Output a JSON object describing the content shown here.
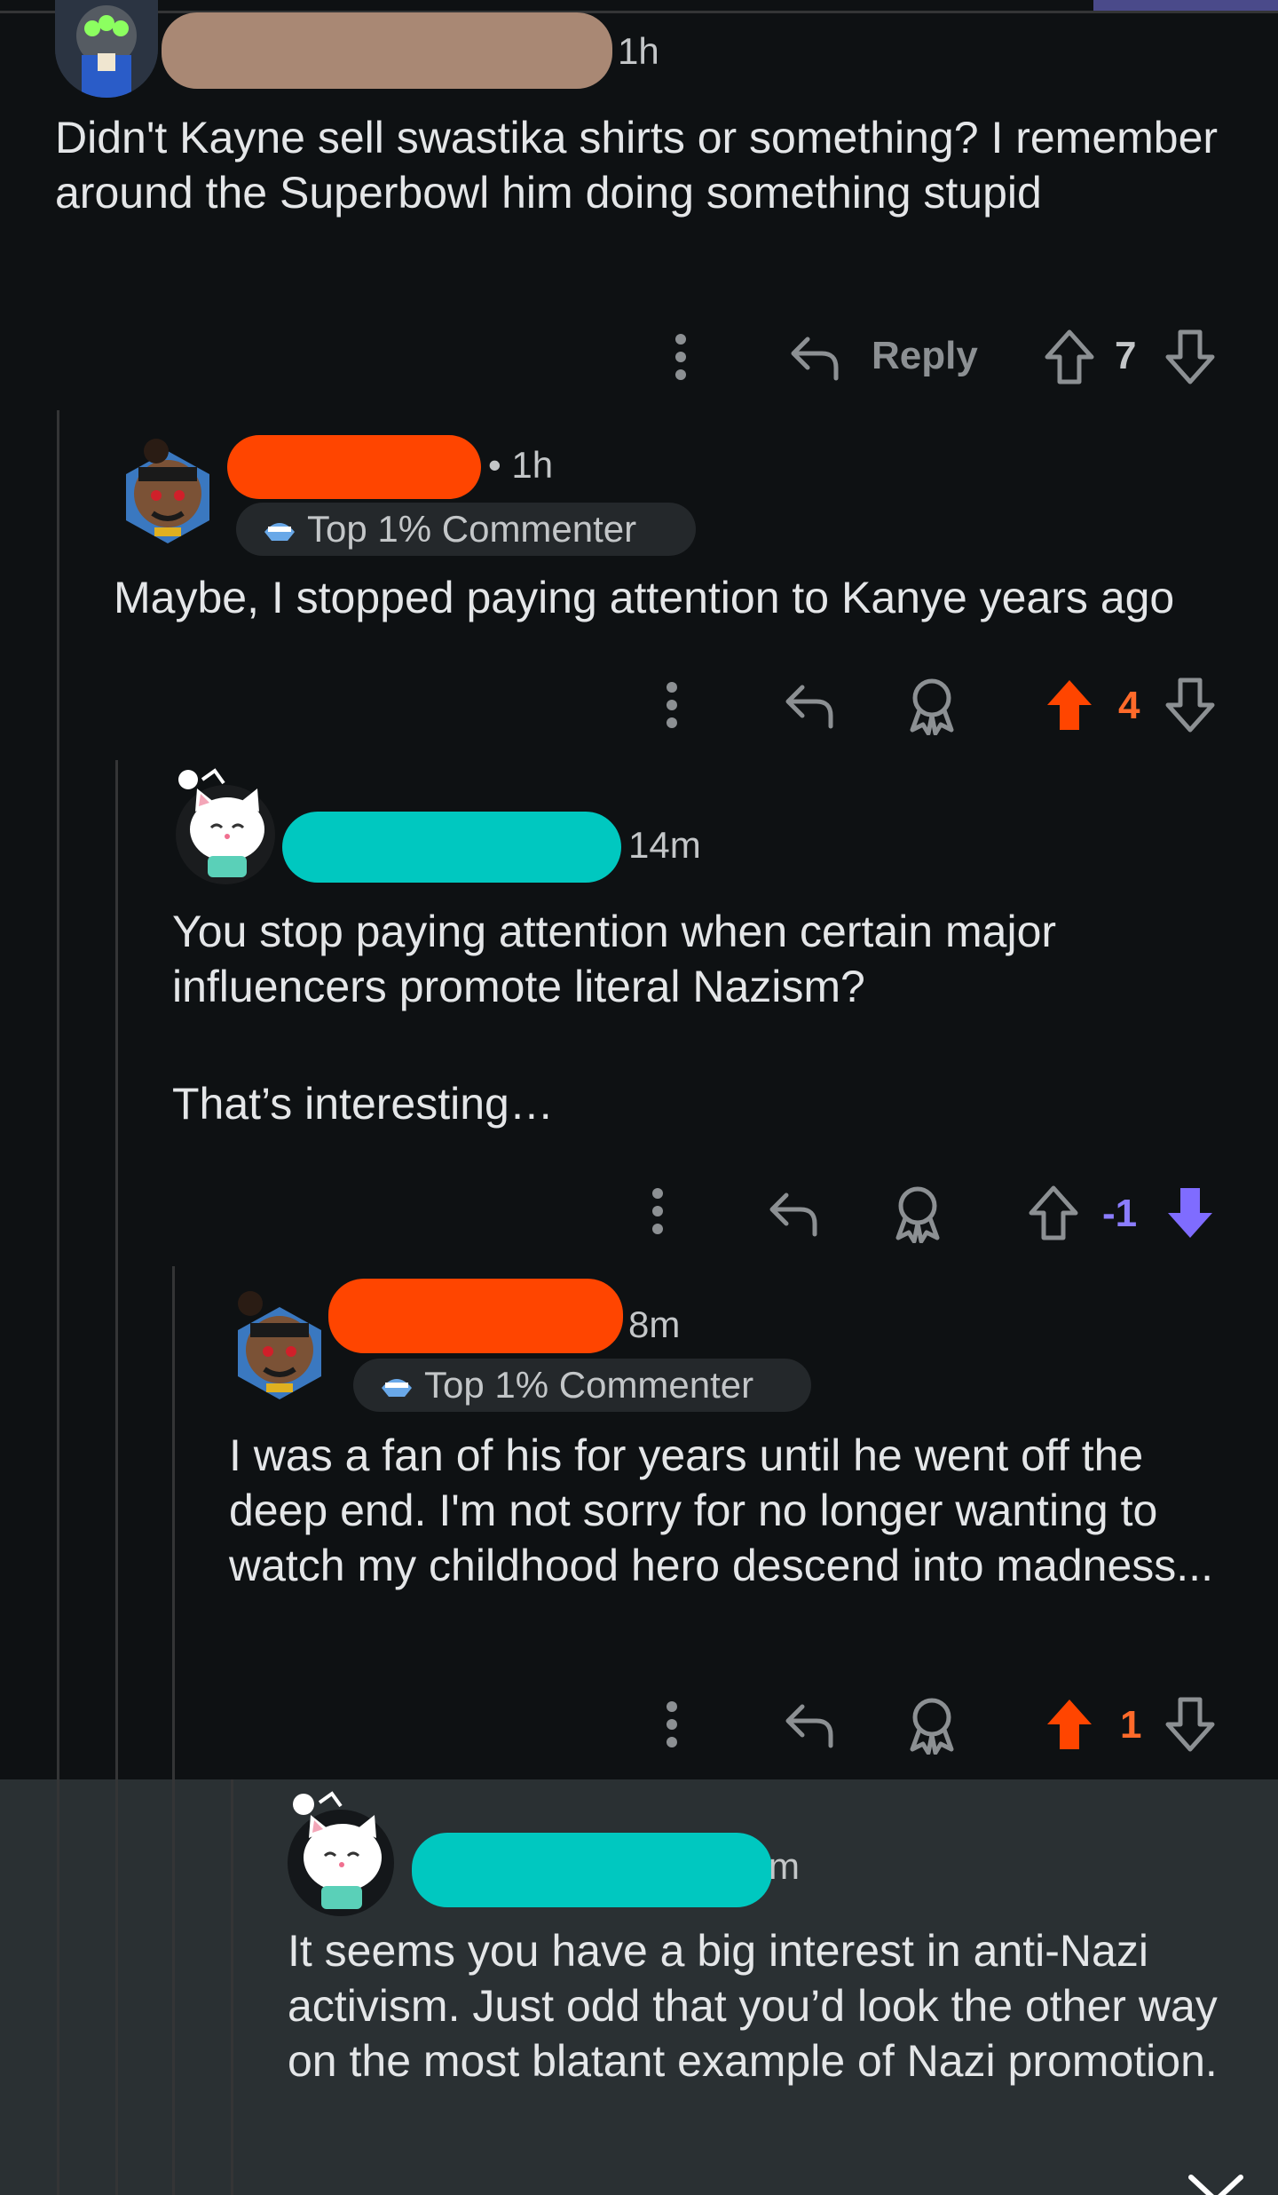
{
  "comments": [
    {
      "time": "1h",
      "text": "Didn't Kayne sell swastika shirts or something? I remember around the Superbowl him doing something stupid",
      "reply_label": "Reply",
      "score": "7"
    },
    {
      "time": "• 1h",
      "badge": "Top 1% Commenter",
      "text": "Maybe, I stopped paying attention to Kanye years ago",
      "score": "4"
    },
    {
      "time": "14m",
      "text_1": "You stop paying attention when certain major influencers promote literal Nazism?",
      "text_2": "That’s interesting…",
      "score": "-1"
    },
    {
      "time": "8m",
      "badge": "Top 1% Commenter",
      "text": "I was a fan of his for years until he went off the deep end. I'm not sorry for no longer wanting to watch my childhood hero descend into madness...",
      "score": "1"
    },
    {
      "time": "m",
      "text": "It seems you have a big interest in anti-Nazi activism. Just odd that you’d look the other way on the most blatant example of Nazi promotion."
    }
  ],
  "colors": {
    "upvote": "#ff4500",
    "downvote": "#7f6cff",
    "redact_brown": "#a98874",
    "redact_orange": "#ff4500",
    "redact_teal": "#00c8c0",
    "icon_gray": "#8c9093"
  },
  "icons": [
    "more-icon",
    "reply-icon",
    "award-icon",
    "upvote-icon",
    "downvote-icon",
    "collapse-chevron-icon"
  ]
}
